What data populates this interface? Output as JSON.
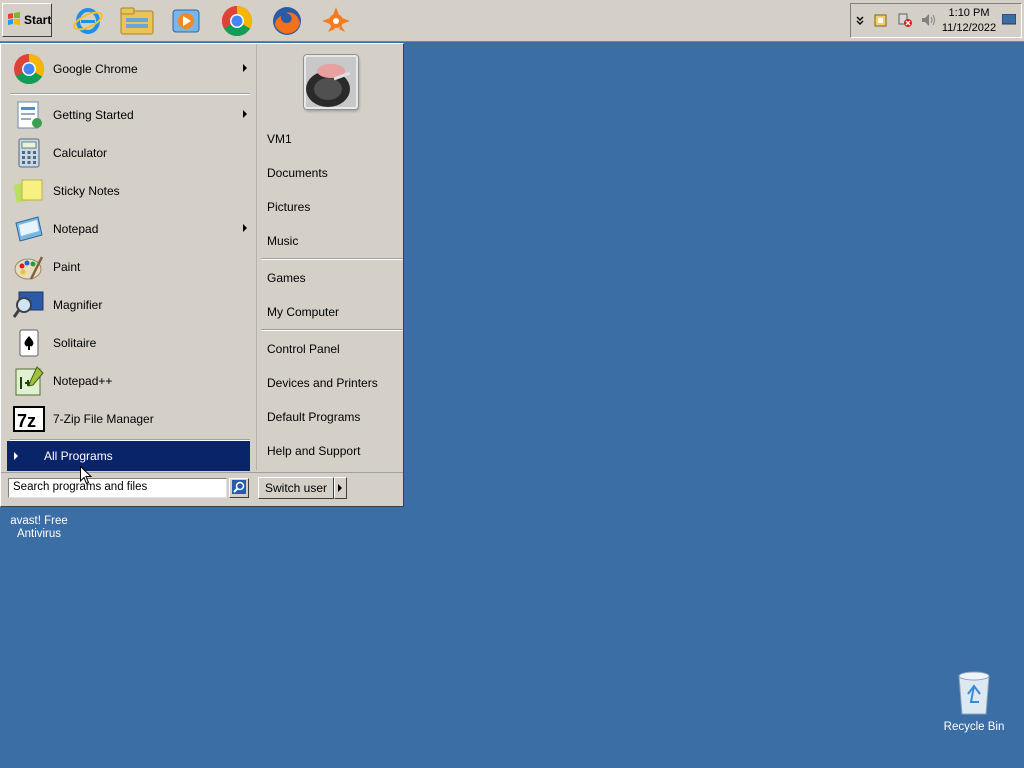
{
  "taskbar": {
    "start_label": "Start",
    "quick_launch": [
      "internet-explorer-icon",
      "windows-explorer-icon",
      "media-player-icon",
      "chrome-icon",
      "firefox-icon",
      "avast-icon"
    ],
    "clock_time": "1:10 PM",
    "clock_date": "11/12/2022"
  },
  "start_menu": {
    "pinned": [
      {
        "label": "Google Chrome",
        "icon": "chrome-icon",
        "has_submenu": true
      }
    ],
    "recent": [
      {
        "label": "Getting Started",
        "icon": "getting-started-icon",
        "has_submenu": true
      },
      {
        "label": "Calculator",
        "icon": "calculator-icon",
        "has_submenu": false
      },
      {
        "label": "Sticky Notes",
        "icon": "sticky-notes-icon",
        "has_submenu": false
      },
      {
        "label": "Notepad",
        "icon": "notepad-icon",
        "has_submenu": true
      },
      {
        "label": "Paint",
        "icon": "paint-icon",
        "has_submenu": false
      },
      {
        "label": "Magnifier",
        "icon": "magnifier-icon",
        "has_submenu": false
      },
      {
        "label": "Solitaire",
        "icon": "solitaire-icon",
        "has_submenu": false
      },
      {
        "label": "Notepad++",
        "icon": "notepad-plus-plus-icon",
        "has_submenu": false
      },
      {
        "label": "7-Zip File Manager",
        "icon": "7zip-icon",
        "has_submenu": false
      }
    ],
    "all_programs": "All Programs",
    "search_placeholder": "Search programs and files",
    "right": {
      "group1": [
        "VM1",
        "Documents",
        "Pictures",
        "Music"
      ],
      "group2": [
        "Games",
        "My Computer"
      ],
      "group3": [
        "Control Panel",
        "Devices and Printers",
        "Default Programs",
        "Help and Support"
      ]
    },
    "switch_user": "Switch user"
  },
  "desktop": {
    "avast_label_1": "avast! Free",
    "avast_label_2": "Antivirus",
    "recycle_bin": "Recycle Bin"
  },
  "colors": {
    "desktop": "#3a6ea5",
    "highlight": "#0a246a",
    "chrome_face": "#d4d0c8"
  }
}
